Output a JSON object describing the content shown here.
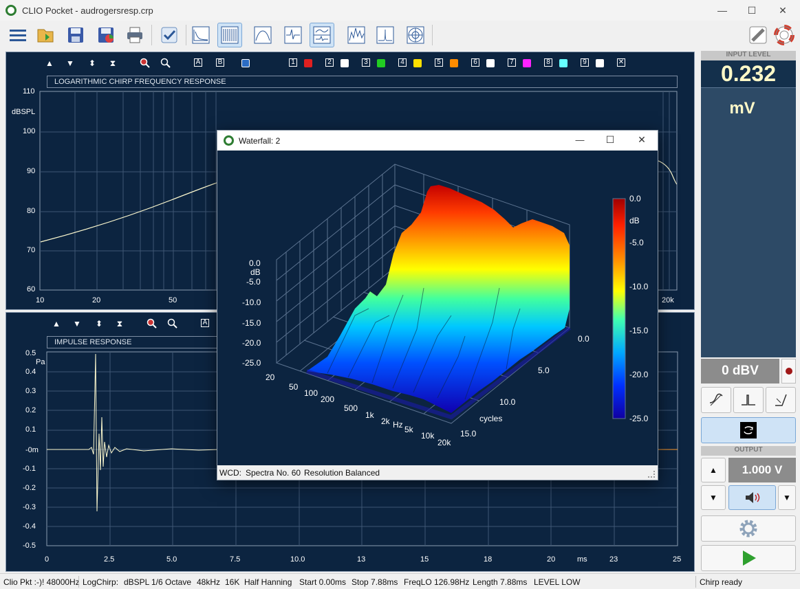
{
  "window": {
    "title": "CLIO Pocket - audrogersresp.crp",
    "controls": {
      "minimize": "—",
      "maximize": "☐",
      "close": "✕"
    }
  },
  "toolbar": {
    "items": [
      "menu-icon",
      "open-folder-icon",
      "save-icon",
      "save-as-icon",
      "print-icon",
      "checkmark-icon",
      "frequency-response-icon",
      "waterfall-icon",
      "filter-icon",
      "impulse-icon",
      "split-view-icon",
      "spectrogram-icon",
      "peak-icon",
      "polar-icon"
    ],
    "right_items": [
      "ruler-icon",
      "lifebuoy-icon"
    ]
  },
  "top_plot": {
    "title": "LOGARITHMIC CHIRP FREQUENCY RESPONSE",
    "ylabel": "dBSPL",
    "y_ticks": [
      "110",
      "100",
      "90",
      "80",
      "70",
      "60"
    ],
    "x_ticks": [
      "10",
      "20",
      "50",
      "20k"
    ],
    "buttons": {
      "a": "A",
      "b": "B"
    },
    "channels": [
      {
        "num": "1",
        "color": "#e02020"
      },
      {
        "num": "2",
        "color": "#ffffff"
      },
      {
        "num": "3",
        "color": "#22cc22"
      },
      {
        "num": "4",
        "color": "#ffe000"
      },
      {
        "num": "5",
        "color": "#ff8c00"
      },
      {
        "num": "6",
        "color": "#ffffff"
      },
      {
        "num": "7",
        "color": "#ff22ff"
      },
      {
        "num": "8",
        "color": "#66ffff"
      },
      {
        "num": "9",
        "color": "#ffffff"
      }
    ],
    "close_all": "✕"
  },
  "bottom_plot": {
    "title": "IMPULSE RESPONSE",
    "ylabel": "Pa",
    "y_ticks": [
      "0.5",
      "0.4",
      "0.3",
      "0.2",
      "0.1",
      "-0m",
      "-0.1",
      "-0.2",
      "-0.3",
      "-0.4",
      "-0.5"
    ],
    "x_ticks": [
      "0",
      "2.5",
      "5.0",
      "7.5",
      "10.0",
      "13",
      "15",
      "18",
      "20",
      "23",
      "25"
    ],
    "x_unit": "ms",
    "buttons": {
      "a": "A"
    }
  },
  "side_panel": {
    "input_level_header": "INPUT LEVEL",
    "input_level_value": "0.232",
    "input_level_unit": "mV",
    "dbv_value": "0 dBV",
    "output_header": "OUTPUT",
    "output_value": "1.000 V"
  },
  "waterfall": {
    "title": "Waterfall: 2",
    "controls": {
      "minimize": "—",
      "maximize": "☐",
      "close": "✕"
    },
    "db_ticks": [
      "0.0",
      "-5.0",
      "-10.0",
      "-15.0",
      "-20.0",
      "-25.0"
    ],
    "db_unit": "dB",
    "freq_ticks": [
      "20",
      "50",
      "100",
      "200",
      "500",
      "1k",
      "2k",
      "5k",
      "10k",
      "20k"
    ],
    "freq_unit": "Hz",
    "cycle_ticks": [
      "0.0",
      "5.0",
      "10.0",
      "15.0"
    ],
    "cycle_unit": "cycles",
    "colorbar_ticks": [
      "0.0",
      "-5.0",
      "-10.0",
      "-15.0",
      "-20.0",
      "-25.0"
    ],
    "colorbar_unit": "dB",
    "status": {
      "wcd": "WCD:",
      "spectra": "Spectra No. 60",
      "resolution": "Resolution Balanced"
    }
  },
  "statusbar": {
    "device": "Clio Pkt :-)! 48000Hz",
    "measure": "LogChirp:",
    "units": "dBSPL",
    "smoothing": "1/6 Octave",
    "rate": "48kHz",
    "size": "16K",
    "window": "Half Hanning",
    "start": "Start 0.00ms",
    "stop": "Stop 7.88ms",
    "freqlo": "FreqLO 126.98Hz",
    "length": "Length 7.88ms",
    "level": "LEVEL LOW",
    "ready": "Chirp ready"
  }
}
